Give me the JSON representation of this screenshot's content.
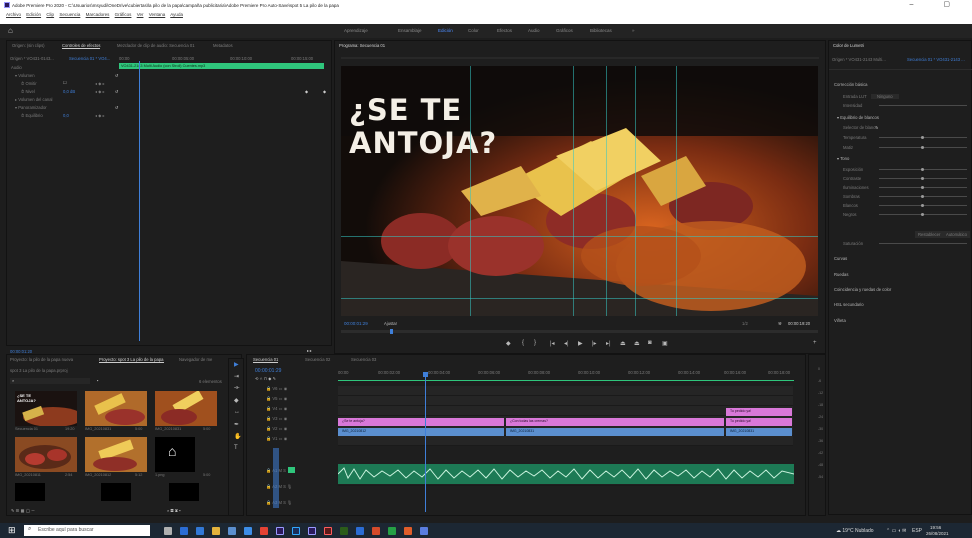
{
  "app": {
    "title": "Adobe Premiere Pro 2020 - C:\\Usuarios\\msyudi\\OneDrive\\cubiertas\\la pilo de la papa\\campaña publicitaria\\Adobe Premiere Pro Auto-Save\\spot 5 La pilo de la papa",
    "menu": [
      "Archivo",
      "Edición",
      "Clip",
      "Secuencia",
      "Marcadores",
      "Gráficos",
      "Ver",
      "Ventana",
      "Ayuda"
    ]
  },
  "workspaces": [
    "Aprendizaje",
    "Ensamblaje",
    "Edición",
    "Color",
    "Efectos",
    "Audio",
    "Gráficos",
    "Bibliotecas",
    "»"
  ],
  "effect_controls": {
    "tabs": [
      "Origen: (sin clips)",
      "Controles de efectos",
      "Mezclador de clip de audio: Secuencia 01",
      "Metadatos"
    ],
    "master": "Origen * VO431-0143...",
    "sequence": "Secuencia 01 * VO4...",
    "timecodes": [
      "00:00",
      "00:00:05:00",
      "00:00:10:00",
      "00:00:15:00"
    ],
    "clip_label": "VO431-2143 Multi Audio (con Stroll) Cuentes.mp3",
    "audio": "Audio",
    "rows": [
      "Volumen",
      "Omitir",
      "Nivel",
      "Volumen del canal",
      "Panoramizador",
      "Equilibrio"
    ],
    "level_val": "0,0 dB",
    "balance_val": "0,0",
    "timecode_bottom": "00:00:01:20"
  },
  "program": {
    "tab": "Programa: Secuencia 01",
    "overlay_line1": "¿SE TE",
    "overlay_line2": "ANTOJA?",
    "timecode": "00:00:01:29",
    "fit": "Ajustar",
    "fraction": "1/2",
    "duration": "00:00:19:20"
  },
  "lumetri": {
    "tab": "Color de Lumetri",
    "master": "Origen * VO431-2143 Multi...",
    "sequence": "Secuencia 01 * VO431-2143 ...",
    "sections": [
      "Corrección básica",
      "Equilibrio de blancos",
      "Tono",
      "Curvas",
      "Ruedas",
      "Coincidencia y ruedas de color",
      "HSL secundario",
      "Viñeta"
    ],
    "input_lut": "Entrada LUT",
    "lut_value": "Ninguno",
    "intensity": "Intensidad",
    "wb_selector": "Selector de blanco",
    "temperature": "Temperatura",
    "tint": "Matiz",
    "tone_rows": [
      "Exposición",
      "Contraste",
      "Iluminaciones",
      "Sombras",
      "Blancos",
      "Negros",
      "Saturación"
    ],
    "buttons": [
      "Restablecer",
      "Automático"
    ]
  },
  "project": {
    "tabs": [
      "Proyecto: la pilo de la papa nueva",
      "Proyecto: spot 3 La pilo de la papa",
      "Navegador de me"
    ],
    "path": "spot 3 La pilo de la papa.prproj",
    "count": "6 elementos",
    "items": [
      {
        "name": "Secuencia 01",
        "dur": "19:20"
      },
      {
        "name": "IMG_20210831",
        "dur": "5:00"
      },
      {
        "name": "IMG_20210831",
        "dur": "5:00"
      },
      {
        "name": "IMG_20210811",
        "dur": "2:54"
      },
      {
        "name": "IMG_20210812",
        "dur": "5:12"
      },
      {
        "name": "1.png",
        "dur": "5:00"
      }
    ],
    "thumb_text": "¿SE TE ANTOJA?"
  },
  "timeline": {
    "tabs": [
      "Secuencia 01",
      "Secuencia 02",
      "Secuencia 03"
    ],
    "timecode": "00:00:01:29",
    "ruler": [
      "00:00",
      "00:00:02:00",
      "00:00:04:00",
      "00:00:06:00",
      "00:00:08:00",
      "00:00:10:00",
      "00:00:12:00",
      "00:00:14:00",
      "00:00:16:00",
      "00:00:18:00"
    ],
    "tracks": [
      "V6",
      "V5",
      "V4",
      "V3",
      "V2",
      "V1",
      "A1",
      "A2",
      "A3"
    ],
    "clips": {
      "v2a": "¿Se te antoja?",
      "v2b": "¿Con todas las cremas?",
      "v2c": "Tu pedido ya!",
      "v1a": "IMG_20210812",
      "v1b": "IMG_20210831",
      "v1c": "IMG_20210831",
      "v3": "Tu pedido ya!"
    },
    "db_marks": [
      "0",
      "-6",
      "-12",
      "-18",
      "-24",
      "-30",
      "-36",
      "-42",
      "-48",
      "-54"
    ]
  },
  "taskbar": {
    "search": "Escribe aquí para buscar",
    "weather": "19°C Nublado",
    "lang": "ESP",
    "time": "19:56",
    "date": "26/08/2021"
  }
}
